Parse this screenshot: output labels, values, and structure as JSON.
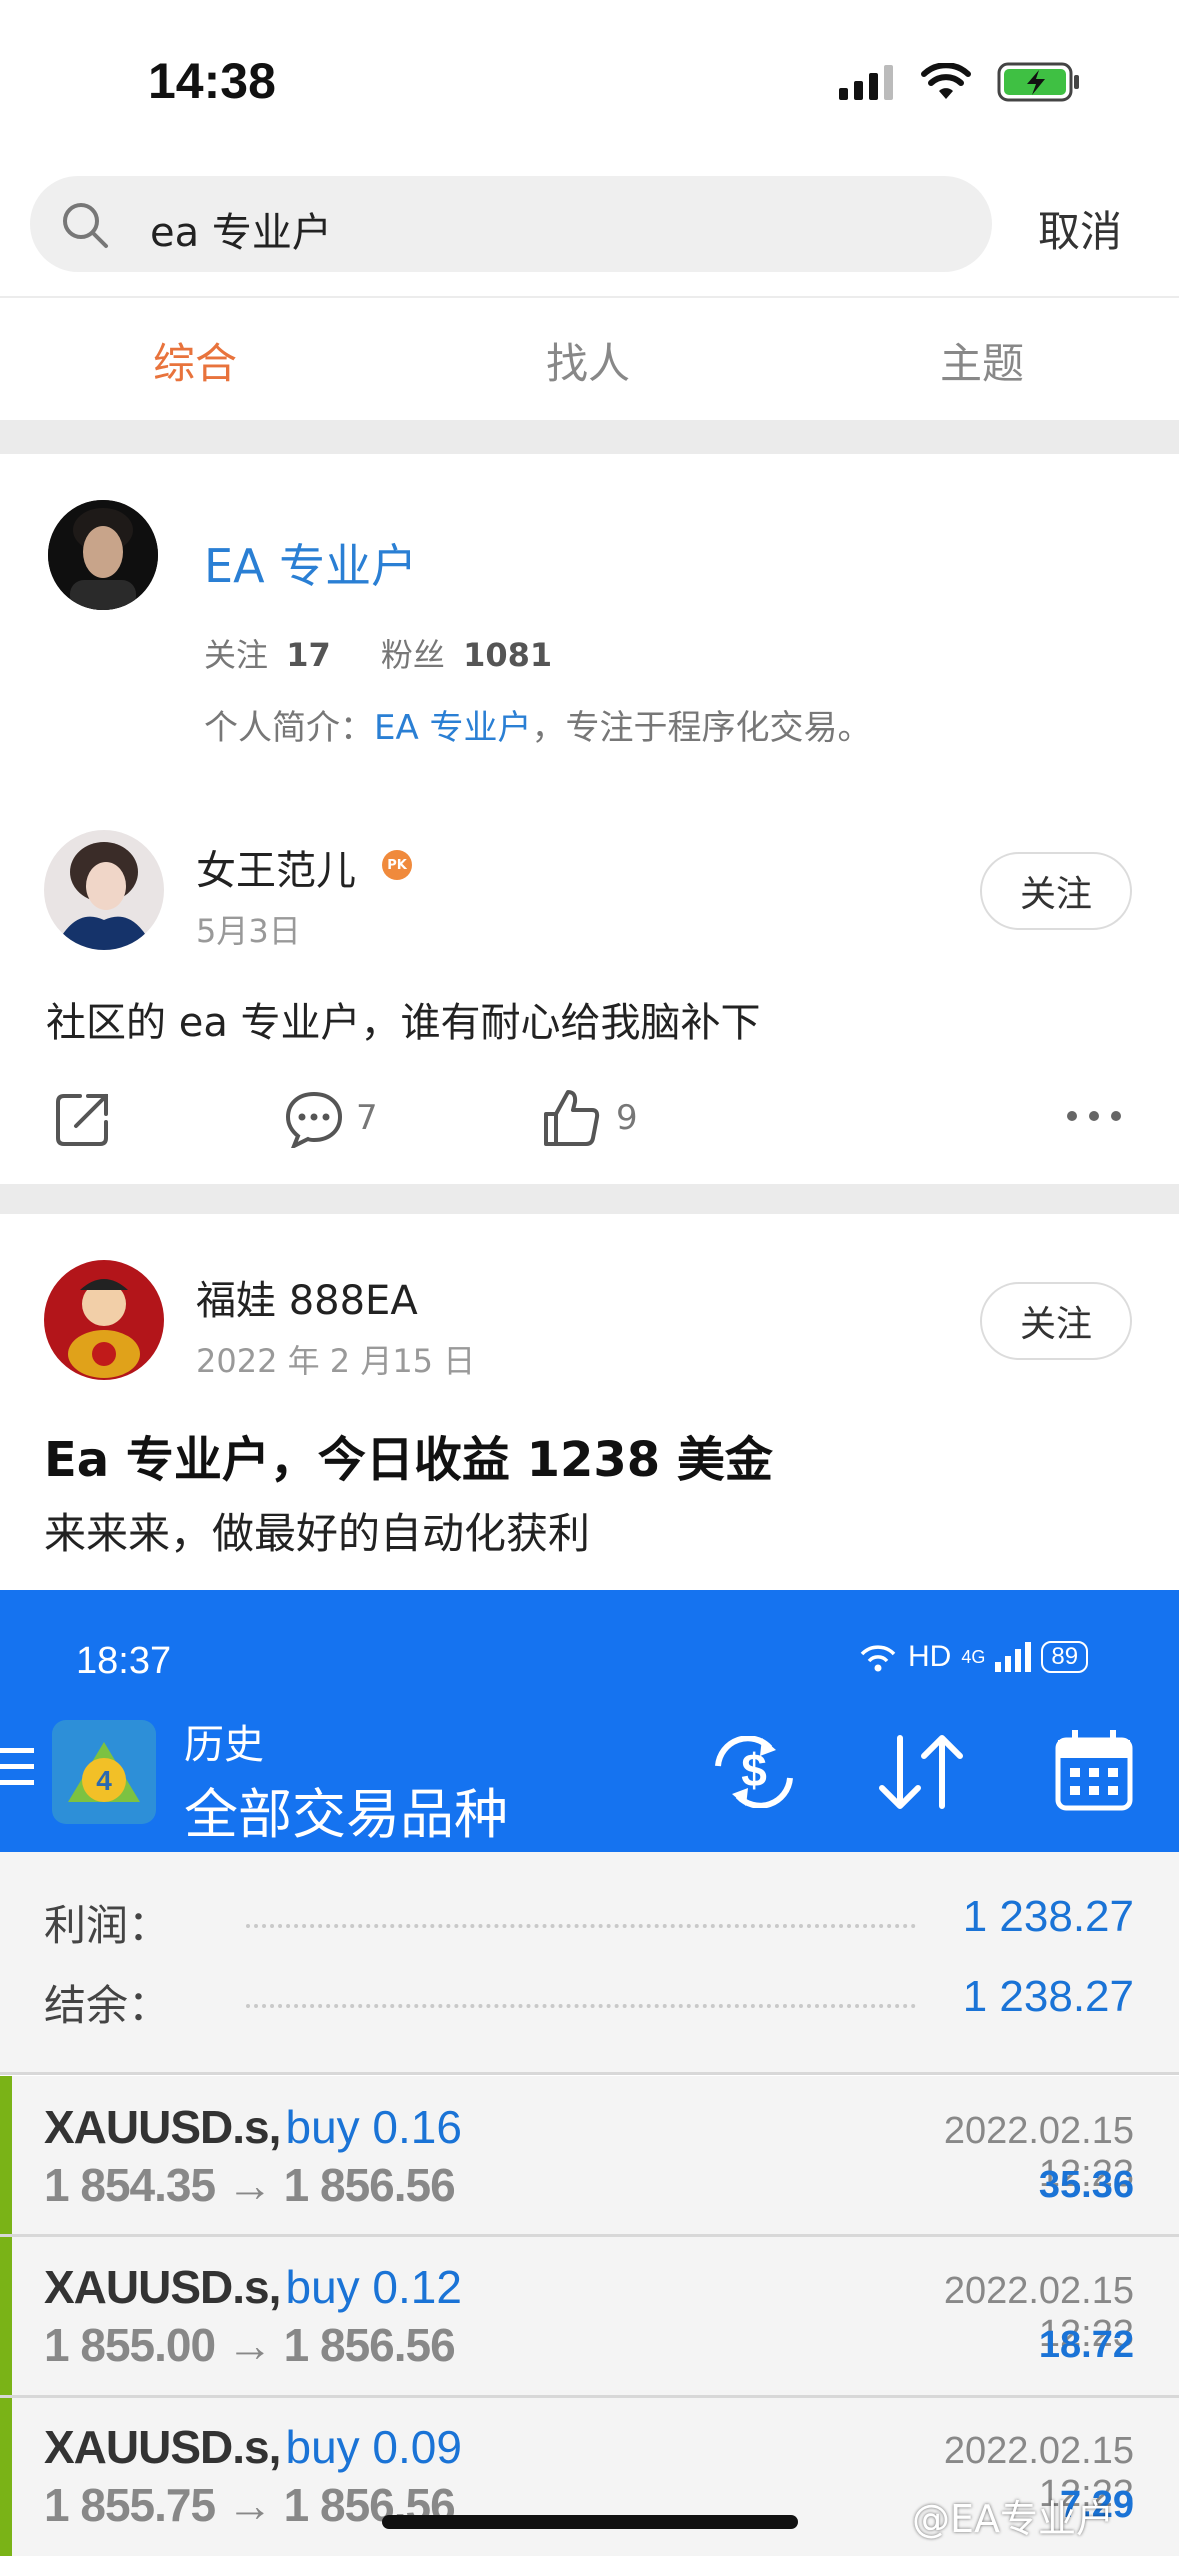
{
  "status": {
    "time": "14:38"
  },
  "search": {
    "query": "ea 专业户",
    "cancel": "取消"
  },
  "tabs": [
    {
      "label": "综合",
      "active": true
    },
    {
      "label": "找人",
      "active": false
    },
    {
      "label": "主题",
      "active": false
    }
  ],
  "user_card": {
    "name": "EA 专业户",
    "follow_label": "关注",
    "follow_count": "17",
    "fans_label": "粉丝",
    "fans_count": "1081",
    "bio_prefix": "个人简介：",
    "bio_link": "EA 专业户",
    "bio_suffix": "，专注于程序化交易。"
  },
  "posts": [
    {
      "author": "女王范儿",
      "badge": "PK",
      "date": "5月3日",
      "follow_button": "关注",
      "text": "社区的 ea 专业户，谁有耐心给我脑补下",
      "comments": "7",
      "likes": "9"
    },
    {
      "author": "福娃 888EA",
      "date": "2022 年 2 月15 日",
      "follow_button": "关注",
      "title": "Ea 专业户，今日收益 1238 美金",
      "text": "来来来，做最好的自动化获利"
    }
  ],
  "mt4": {
    "time": "18:37",
    "battery": "89",
    "network": "HD",
    "signal": "4G",
    "header_small": "历史",
    "header_large": "全部交易品种",
    "profit_label": "利润：",
    "profit_value": "1 238.27",
    "balance_label": "结余：",
    "balance_value": "1 238.27",
    "trades": [
      {
        "symbol": "XAUUSD.s,",
        "side": "buy 0.16",
        "date": "2022.02.15 12:23",
        "prices": "1 854.35 → 1 856.56",
        "profit": "35.36"
      },
      {
        "symbol": "XAUUSD.s,",
        "side": "buy 0.12",
        "date": "2022.02.15 12:23",
        "prices": "1 855.00 → 1 856.56",
        "profit": "18.72"
      },
      {
        "symbol": "XAUUSD.s,",
        "side": "buy 0.09",
        "date": "2022.02.15 12:23",
        "prices": "1 855.75 → 1 856.56",
        "profit": "7.29"
      }
    ]
  },
  "watermark": "@EA专业户",
  "colors": {
    "accent": "#e8733c",
    "link": "#2a7fd4",
    "mt_blue": "#1573f0",
    "trade_bar": "#7ab317"
  }
}
